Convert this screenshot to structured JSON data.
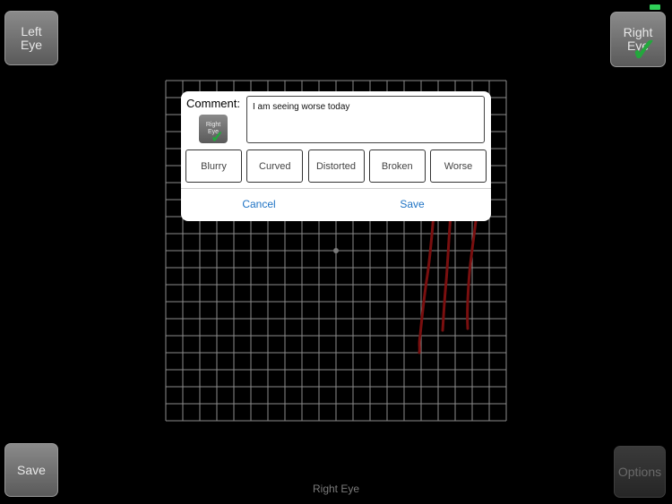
{
  "controls": {
    "left_eye_line1": "Left",
    "left_eye_line2": "Eye",
    "right_eye_line1": "Right",
    "right_eye_line2": "Eye",
    "right_eye_check": "✓",
    "save_label": "Save",
    "options_label": "Options"
  },
  "status_bar": {
    "battery_color": "#2fd158"
  },
  "grid": {
    "cells": 20,
    "line_color": "#8c8c8c",
    "center_dot_color": "#7a7a7a",
    "stroke_color": "#7a0f0f"
  },
  "footer": {
    "eye_label": "Right Eye"
  },
  "dialog": {
    "comment_label": "Comment:",
    "eye_badge_line1": "Right",
    "eye_badge_line2": "Eye",
    "eye_badge_check": "✓",
    "comment_text": "I am seeing worse today",
    "tags": [
      "Blurry",
      "Curved",
      "Distorted",
      "Broken",
      "Worse"
    ],
    "cancel_label": "Cancel",
    "save_label": "Save",
    "accent_color": "#1f73c4"
  }
}
